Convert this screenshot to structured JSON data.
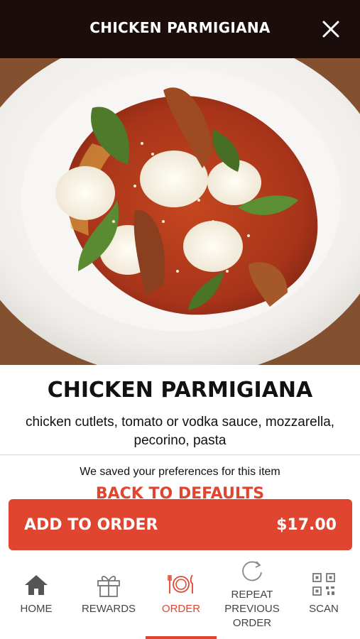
{
  "header": {
    "title": "CHICKEN PARMIGIANA"
  },
  "item": {
    "name": "CHICKEN PARMIGIANA",
    "description": "chicken cutlets, tomato or vodka sauce, mozzarella, pecorino, pasta",
    "preferences_note": "We saved your preferences for this item",
    "back_to_defaults": "BACK TO DEFAULTS"
  },
  "cta": {
    "label": "ADD TO ORDER",
    "price": "$17.00"
  },
  "colors": {
    "accent": "#e0452f",
    "header_bg": "#1b0d0b"
  },
  "tabs": [
    {
      "label": "HOME",
      "icon": "home-icon"
    },
    {
      "label": "REWARDS",
      "icon": "gift-icon"
    },
    {
      "label": "ORDER",
      "icon": "plate-cutlery-icon",
      "active": true
    },
    {
      "label": "REPEAT PREVIOUS ORDER",
      "icon": "repeat-icon"
    },
    {
      "label": "SCAN",
      "icon": "qr-code-icon"
    }
  ]
}
